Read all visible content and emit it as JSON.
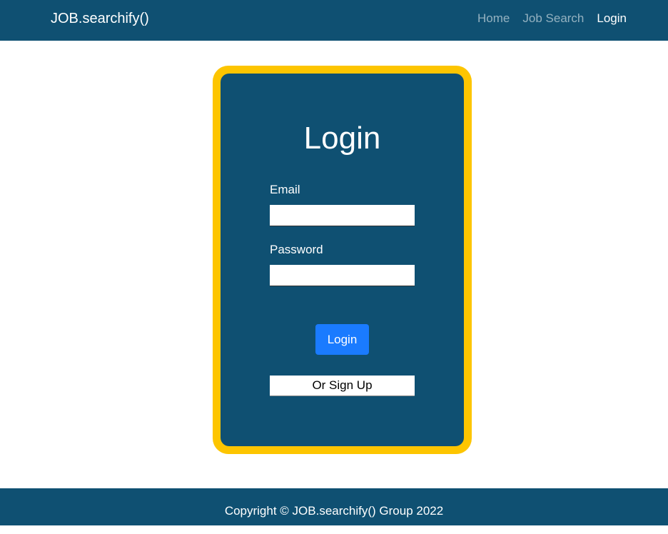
{
  "navbar": {
    "brand": "JOB.searchify()",
    "links": [
      {
        "label": "Home",
        "active": false
      },
      {
        "label": "Job Search",
        "active": false
      },
      {
        "label": "Login",
        "active": true
      }
    ]
  },
  "login_card": {
    "title": "Login",
    "email_label": "Email",
    "email_value": "",
    "password_label": "Password",
    "password_value": "",
    "submit_label": "Login",
    "signup_label": "Or Sign Up"
  },
  "footer": {
    "copyright": "Copyright © JOB.searchify() Group 2022"
  },
  "colors": {
    "primary": "#0f5072",
    "card_border": "#fdc500",
    "button": "#1a7bff"
  }
}
